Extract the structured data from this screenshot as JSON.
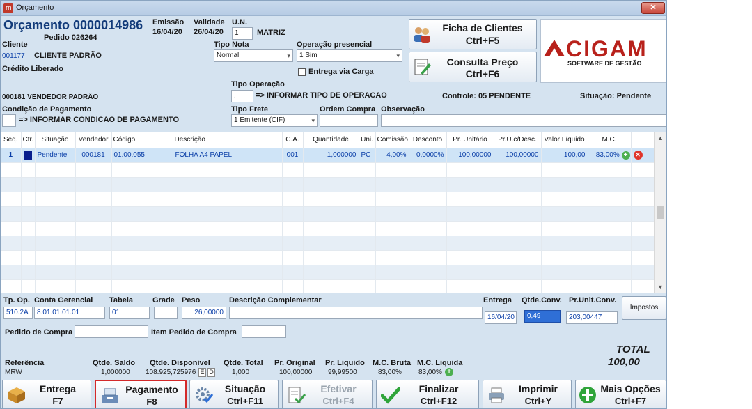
{
  "window": {
    "title": "Orçamento",
    "app_icon_letter": "m",
    "close_glyph": "✕"
  },
  "header": {
    "orcamento_title": "Orçamento 0000014986",
    "pedido": "Pedido 026264",
    "emissao_label": "Emissão",
    "emissao_value": "16/04/20",
    "validade_label": "Validade",
    "validade_value": "26/04/20",
    "un_label": "U.N.",
    "un_value": "1",
    "un_name": "MATRIZ",
    "cliente_label": "Cliente",
    "cliente_code": "001177",
    "cliente_name": "CLIENTE PADRÃO",
    "credito": "Crédito Liberado",
    "tipo_nota_label": "Tipo Nota",
    "tipo_nota_value": "Normal",
    "operacao_presencial_label": "Operação presencial",
    "operacao_presencial_value": "1 Sim",
    "entrega_via_carga": "Entrega via Carga",
    "tipo_operacao_label": "Tipo Operação",
    "tipo_operacao_value": ".",
    "tipo_operacao_msg": "=> INFORMAR TIPO DE OPERACAO",
    "vendedor": "000181  VENDEDOR PADRÃO",
    "controle": "Controle: 05  PENDENTE",
    "situacao": "Situação: Pendente",
    "condicao_label": "Condição de Pagamento",
    "condicao_msg": "=> INFORMAR CONDICAO DE PAGAMENTO",
    "tipo_frete_label": "Tipo Frete",
    "tipo_frete_value": "1 Emitente (CIF)",
    "ordem_compra_label": "Ordem Compra",
    "observacao_label": "Observação"
  },
  "side_buttons": {
    "ficha_line1": "Ficha de Clientes",
    "ficha_line2": "Ctrl+F5",
    "consulta_line1": "Consulta Preço",
    "consulta_line2": "Ctrl+F6"
  },
  "logo": {
    "name": "CIGAM",
    "tagline": "SOFTWARE DE GESTÃO"
  },
  "grid": {
    "columns": [
      "Seq.",
      "Ctr.",
      "Situação",
      "Vendedor",
      "Código",
      "Descrição",
      "C.A.",
      "Quantidade",
      "Uni.",
      "Comissão",
      "Desconto",
      "Pr. Unitário",
      "Pr.U.c/Desc.",
      "Valor Líquido",
      "M.C.",
      ""
    ],
    "rows": [
      {
        "seq": "1",
        "situacao": "Pendente",
        "vendedor": "000181",
        "codigo": "01.00.055",
        "descricao": "FOLHA A4 PAPEL",
        "ca": "001",
        "quantidade": "1,000000",
        "uni": "PC",
        "comissao": "4,00%",
        "desconto": "0,0000%",
        "pr_unitario": "100,00000",
        "pr_uc_desc": "100,00000",
        "valor_liquido": "100,00",
        "mc": "83,00%"
      }
    ]
  },
  "bottom": {
    "tp_op_label": "Tp. Op.",
    "tp_op_value": "510.2A",
    "conta_label": "Conta Gerencial",
    "conta_value": "8.01.01.01.01",
    "tabela_label": "Tabela",
    "tabela_value": "01",
    "grade_label": "Grade",
    "peso_label": "Peso",
    "peso_value": "26,00000",
    "desc_comp_label": "Descrição Complementar",
    "entrega_label": "Entrega",
    "entrega_value": "16/04/20",
    "qtde_conv_label": "Qtde.Conv.",
    "qtde_conv_value": "0,49",
    "pr_unit_conv_label": "Pr.Unit.Conv.",
    "pr_unit_conv_value": "203,00447",
    "impostos": "Impostos",
    "pedido_compra_label": "Pedido de Compra",
    "item_pedido_label": "Item Pedido de Compra",
    "total_label": "TOTAL",
    "total_value": "100,00",
    "referencia_label": "Referência",
    "referencia_value": "MRW",
    "qtde_saldo_label": "Qtde. Saldo",
    "qtde_saldo_value": "1,000000",
    "qtde_disp_label": "Qtde. Disponível",
    "qtde_disp_value": "108.925,725976",
    "qtde_total_label": "Qtde. Total",
    "qtde_total_value": "1,000",
    "pr_original_label": "Pr. Original",
    "pr_original_value": "100,00000",
    "pr_liquido_label": "Pr. Liquido",
    "pr_liquido_value": "99,99500",
    "mc_bruta_label": "M.C. Bruta",
    "mc_bruta_value": "83,00%",
    "mc_liquida_label": "M.C. Liquida",
    "mc_liquida_value": "83,00%",
    "e_btn": "E",
    "d_btn": "D"
  },
  "footer_buttons": [
    {
      "line1": "Entrega",
      "line2": "F7"
    },
    {
      "line1": "Pagamento",
      "line2": "F8"
    },
    {
      "line1": "Situação",
      "line2": "Ctrl+F11"
    },
    {
      "line1": "Efetivar",
      "line2": "Ctrl+F4"
    },
    {
      "line1": "Finalizar",
      "line2": "Ctrl+F12"
    },
    {
      "line1": "Imprimir",
      "line2": "Ctrl+Y"
    },
    {
      "line1": "Mais Opções",
      "line2": "Ctrl+F7"
    }
  ],
  "colors": {
    "selected_row": "#cfe4f7",
    "highlight_border": "#d42a2a",
    "window_bg": "#d5e3f0"
  }
}
